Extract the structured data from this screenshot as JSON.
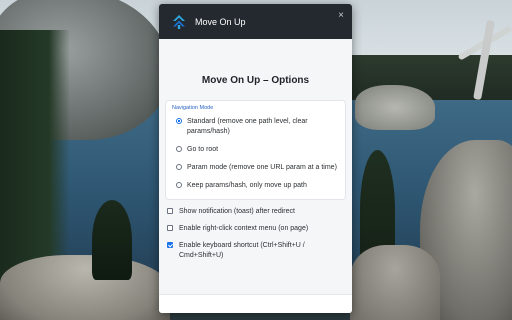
{
  "popup": {
    "app_name": "Move On Up",
    "logo_icon": "double-chevron-up-icon",
    "close_glyph": "×",
    "heading": "Move On Up – Options",
    "navigation": {
      "legend": "Navigation Mode",
      "options": [
        {
          "label": "Standard (remove one path level, clear params/hash)",
          "checked": true
        },
        {
          "label": "Go to root",
          "checked": false
        },
        {
          "label": "Param mode (remove one URL param at a time)",
          "checked": false
        },
        {
          "label": "Keep params/hash, only move up path",
          "checked": false
        }
      ]
    },
    "checkboxes": [
      {
        "label": "Show notification (toast) after redirect",
        "checked": false
      },
      {
        "label": "Enable right-click context menu (on page)",
        "checked": false
      },
      {
        "label": "Enable keyboard shortcut (Ctrl+Shift+U / Cmd+Shift+U)",
        "checked": true
      }
    ],
    "colors": {
      "titlebar": "#23292f",
      "accent": "#1a73e8",
      "logo_primary": "#2ea7e0",
      "logo_secondary": "#1b6fd0"
    }
  }
}
